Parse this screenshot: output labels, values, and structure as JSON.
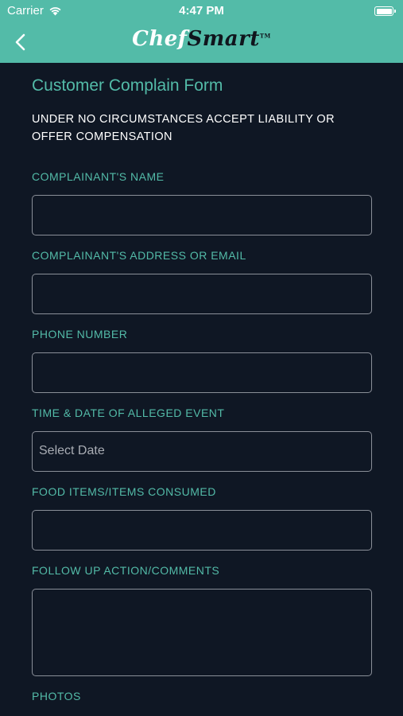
{
  "status": {
    "carrier": "Carrier",
    "time": "4:47 PM"
  },
  "nav": {
    "logo_chef": "Chef",
    "logo_smart": "Smart",
    "logo_tm": "TM"
  },
  "form": {
    "title": "Customer Complain Form",
    "warning": "UNDER NO CIRCUMSTANCES ACCEPT LIABILITY OR OFFER COMPENSATION",
    "fields": [
      {
        "label": "COMPLAINANT'S NAME",
        "value": ""
      },
      {
        "label": "COMPLAINANT'S ADDRESS OR EMAIL",
        "value": ""
      },
      {
        "label": "PHONE NUMBER",
        "value": ""
      },
      {
        "label": "TIME & DATE OF ALLEGED EVENT",
        "placeholder": "Select Date"
      },
      {
        "label": "FOOD ITEMS/ITEMS CONSUMED",
        "value": ""
      },
      {
        "label": "FOLLOW UP ACTION/COMMENTS",
        "value": ""
      }
    ],
    "photos_label": "PHOTOS"
  },
  "colors": {
    "accent": "#53bba8",
    "background": "#0f1724",
    "field_border": "#8a8f98"
  }
}
